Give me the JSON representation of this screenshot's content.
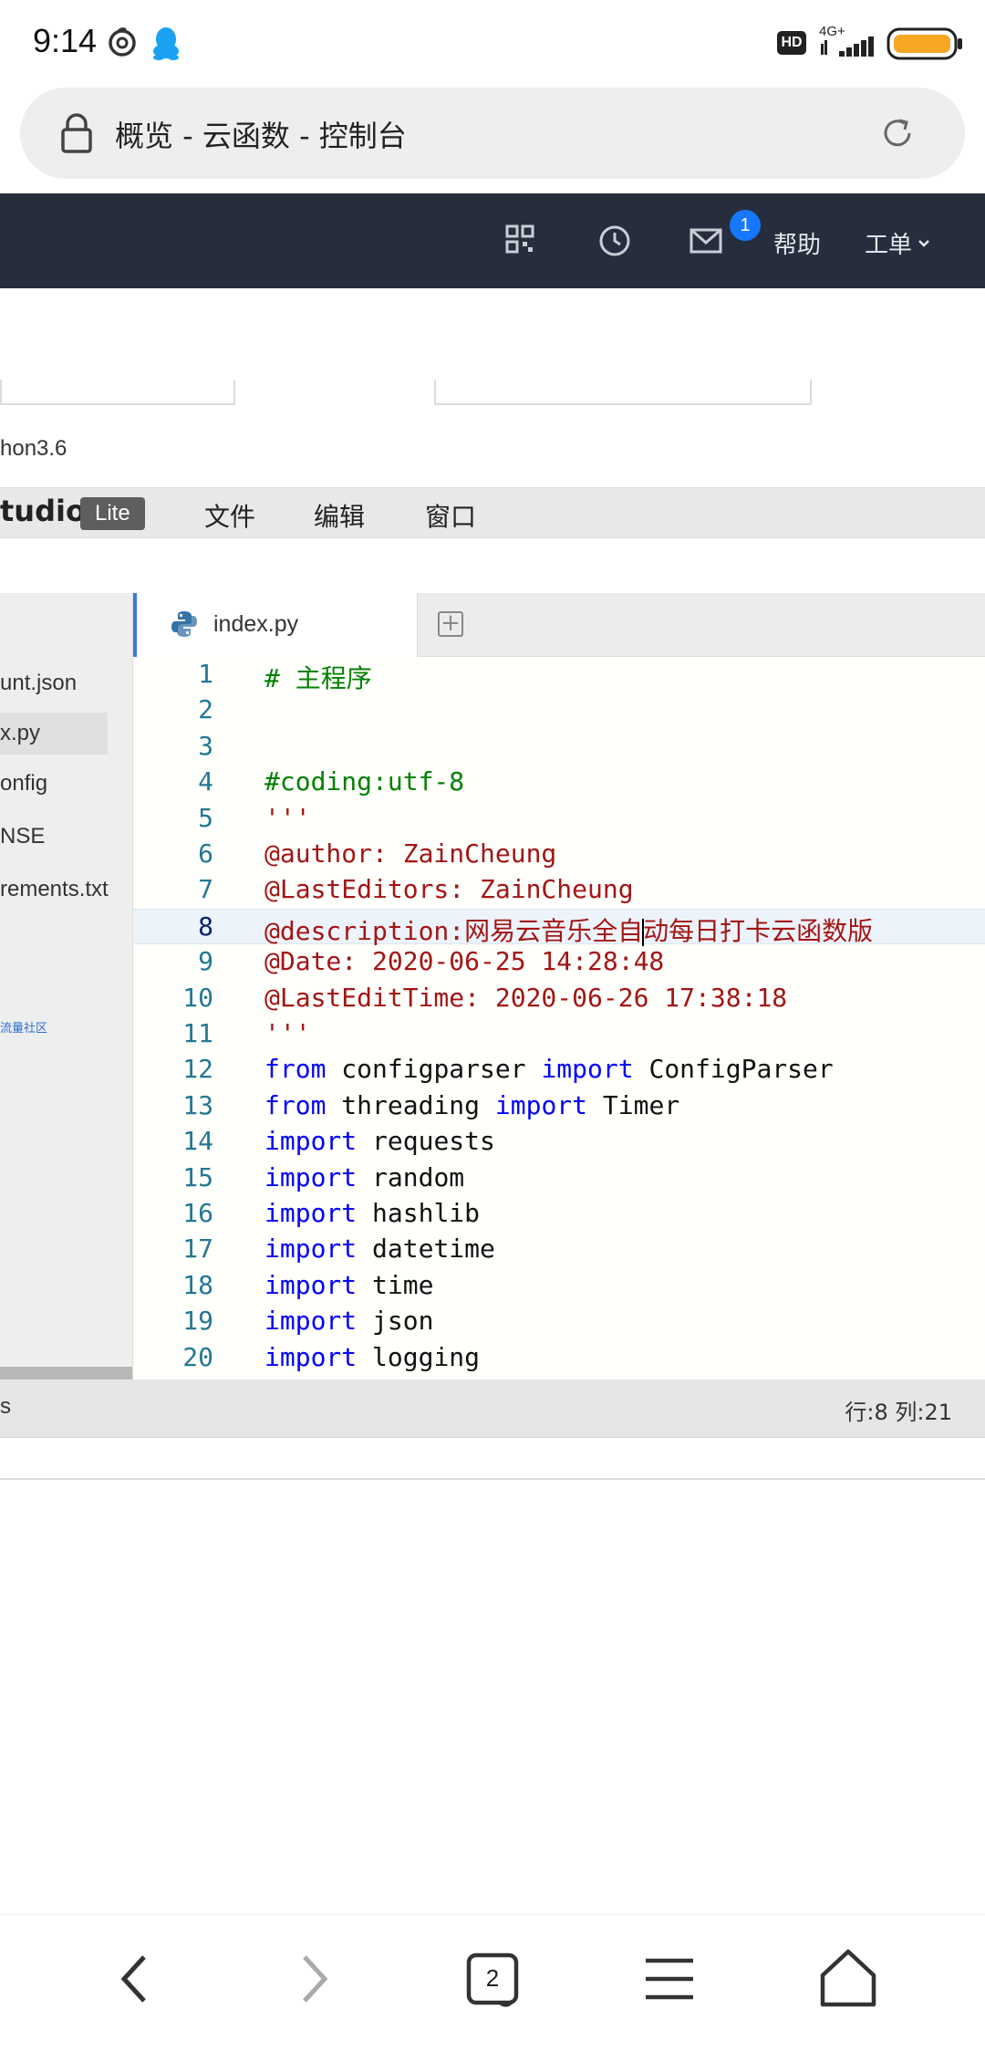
{
  "status_bar": {
    "time": "9:14",
    "hd_label": "HD",
    "network": "4G+",
    "battery_color": "#f5a623"
  },
  "address_bar": {
    "title": "概览 - 云函数 - 控制台"
  },
  "top_nav": {
    "mail_badge_count": "1",
    "help_label": "帮助",
    "ticket_label": "工单"
  },
  "config": {
    "runtime_text": "hon3.6"
  },
  "studio_bar": {
    "brand": "tudio",
    "lite_badge": "Lite",
    "menu": [
      "文件",
      "编辑",
      "窗口"
    ]
  },
  "sidebar": {
    "files": [
      "unt.json",
      "x.py",
      "onfig",
      "NSE",
      "rements.txt"
    ],
    "active_index": 1,
    "community_link": "流量社区"
  },
  "editor": {
    "tab_label": "index.py",
    "add_tab_glyph": "+",
    "current_line": 8,
    "lines": [
      {
        "n": "1",
        "t": [
          {
            "c": "comment",
            "s": "# 主程序"
          }
        ]
      },
      {
        "n": "2",
        "t": []
      },
      {
        "n": "3",
        "t": []
      },
      {
        "n": "4",
        "t": [
          {
            "c": "comment",
            "s": "#coding:utf-8"
          }
        ]
      },
      {
        "n": "5",
        "t": [
          {
            "c": "string",
            "s": "'''"
          }
        ]
      },
      {
        "n": "6",
        "t": [
          {
            "c": "string",
            "s": "@author: ZainCheung"
          }
        ]
      },
      {
        "n": "7",
        "t": [
          {
            "c": "string",
            "s": "@LastEditors: ZainCheung"
          }
        ]
      },
      {
        "n": "8",
        "t": [
          {
            "c": "string",
            "s": "@description:网易云音乐全自"
          },
          {
            "c": "caret",
            "s": ""
          },
          {
            "c": "string",
            "s": "动每日打卡云函数版"
          }
        ]
      },
      {
        "n": "9",
        "t": [
          {
            "c": "string",
            "s": "@Date: 2020-06-25 14:28:48"
          }
        ]
      },
      {
        "n": "10",
        "t": [
          {
            "c": "string",
            "s": "@LastEditTime: 2020-06-26 17:38:18"
          }
        ]
      },
      {
        "n": "11",
        "t": [
          {
            "c": "string",
            "s": "'''"
          }
        ]
      },
      {
        "n": "12",
        "t": [
          {
            "c": "keyword",
            "s": "from"
          },
          {
            "c": "plain",
            "s": " configparser "
          },
          {
            "c": "keyword",
            "s": "import"
          },
          {
            "c": "plain",
            "s": " ConfigParser"
          }
        ]
      },
      {
        "n": "13",
        "t": [
          {
            "c": "keyword",
            "s": "from"
          },
          {
            "c": "plain",
            "s": " threading "
          },
          {
            "c": "keyword",
            "s": "import"
          },
          {
            "c": "plain",
            "s": " Timer"
          }
        ]
      },
      {
        "n": "14",
        "t": [
          {
            "c": "keyword",
            "s": "import"
          },
          {
            "c": "plain",
            "s": " requests"
          }
        ]
      },
      {
        "n": "15",
        "t": [
          {
            "c": "keyword",
            "s": "import"
          },
          {
            "c": "plain",
            "s": " random"
          }
        ]
      },
      {
        "n": "16",
        "t": [
          {
            "c": "keyword",
            "s": "import"
          },
          {
            "c": "plain",
            "s": " hashlib"
          }
        ]
      },
      {
        "n": "17",
        "t": [
          {
            "c": "keyword",
            "s": "import"
          },
          {
            "c": "plain",
            "s": " datetime"
          }
        ]
      },
      {
        "n": "18",
        "t": [
          {
            "c": "keyword",
            "s": "import"
          },
          {
            "c": "plain",
            "s": " time"
          }
        ]
      },
      {
        "n": "19",
        "t": [
          {
            "c": "keyword",
            "s": "import"
          },
          {
            "c": "plain",
            "s": " json"
          }
        ]
      },
      {
        "n": "20",
        "t": [
          {
            "c": "keyword",
            "s": "import"
          },
          {
            "c": "plain",
            "s": " logging"
          }
        ]
      }
    ]
  },
  "editor_status": {
    "left_text": "s",
    "cursor_position": "行:8 列:21"
  },
  "bottom_nav": {
    "tab_count": "2"
  }
}
